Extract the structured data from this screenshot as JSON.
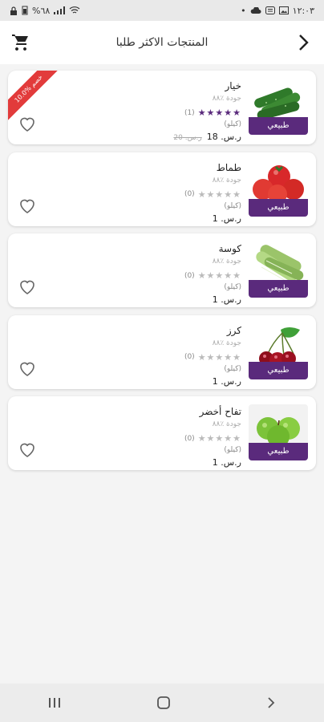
{
  "status": {
    "time": "١٢:٠٣",
    "battery": "%٦٨"
  },
  "header": {
    "title": "المنتجات الاكثر طلبا"
  },
  "colors": {
    "accent": "#5a2a7c",
    "discount": "#e23b3b"
  },
  "products": [
    {
      "name": "خيار",
      "quality": "جودة ٪٨٨",
      "rating_count": "(1)",
      "stars_filled": 5,
      "unit": "(كيلو)",
      "price": "ر.س. 18",
      "old_price": "ر.س. 20",
      "badge": "طبيعي",
      "discount": "10.0% خصم",
      "image": "cucumber"
    },
    {
      "name": "طماط",
      "quality": "جودة ٪٨٨",
      "rating_count": "(0)",
      "stars_filled": 0,
      "unit": "(كيلو)",
      "price": "ر.س. 1",
      "old_price": "",
      "badge": "طبيعي",
      "discount": "",
      "image": "tomato"
    },
    {
      "name": "كوسة",
      "quality": "جودة ٪٨٨",
      "rating_count": "(0)",
      "stars_filled": 0,
      "unit": "(كيلو)",
      "price": "ر.س. 1",
      "old_price": "",
      "badge": "طبيعي",
      "discount": "",
      "image": "zucchini"
    },
    {
      "name": "كرز",
      "quality": "جودة ٪٨٨",
      "rating_count": "(0)",
      "stars_filled": 0,
      "unit": "(كيلو)",
      "price": "ر.س. 1",
      "old_price": "",
      "badge": "طبيعي",
      "discount": "",
      "image": "cherry"
    },
    {
      "name": "تفاح أخضر",
      "quality": "جودة ٪٨٨",
      "rating_count": "(0)",
      "stars_filled": 0,
      "unit": "(كيلو)",
      "price": "ر.س. 1",
      "old_price": "",
      "badge": "طبيعي",
      "discount": "",
      "image": "green-apple"
    }
  ]
}
